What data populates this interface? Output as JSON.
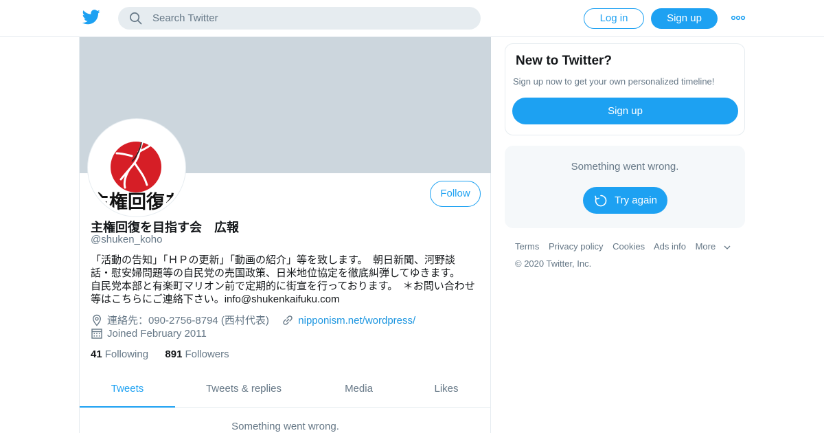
{
  "header": {
    "search_placeholder": "Search Twitter",
    "login_label": "Log in",
    "signup_label": "Sign up",
    "brand_color": "#1da1f2"
  },
  "profile": {
    "display_name": "主権回復を目指す会　広報",
    "handle": "@shuken_koho",
    "bio_lines": [
      "「活動の告知」「ＨＰの更新」「動画の紹介」等を致します。　朝日新聞、河野談",
      "話・慰安婦問題等の自民党の売国政策、日米地位協定を徹底糾弾してゆきます。",
      "自民党本部と有楽町マリオン前で定期的に街宣を行っております。　＊お問い合わせ",
      "等はこちらにご連絡下さい。info@shukenkaifuku.com"
    ],
    "location": "連絡先：090-2756-8794 (西村代表)",
    "website": "nipponism.net/wordpress/",
    "joined": "Joined February 2011",
    "following_count": "41",
    "following_label": "Following",
    "followers_count": "891",
    "followers_label": "Followers",
    "follow_label": "Follow",
    "avatar_text": "主権回復を"
  },
  "tabs": [
    {
      "label": "Tweets",
      "active": true
    },
    {
      "label": "Tweets & replies",
      "active": false
    },
    {
      "label": "Media",
      "active": false
    },
    {
      "label": "Likes",
      "active": false
    }
  ],
  "feed": {
    "error_text": "Something went wrong."
  },
  "sidebar": {
    "new_title": "New to Twitter?",
    "new_sub": "Sign up now to get your own personalized timeline!",
    "new_signup_label": "Sign up",
    "error_text": "Something went wrong.",
    "retry_label": "Try again",
    "footer_links": [
      "Terms",
      "Privacy policy",
      "Cookies",
      "Ads info",
      "More"
    ],
    "copyright": "© 2020 Twitter, Inc."
  }
}
